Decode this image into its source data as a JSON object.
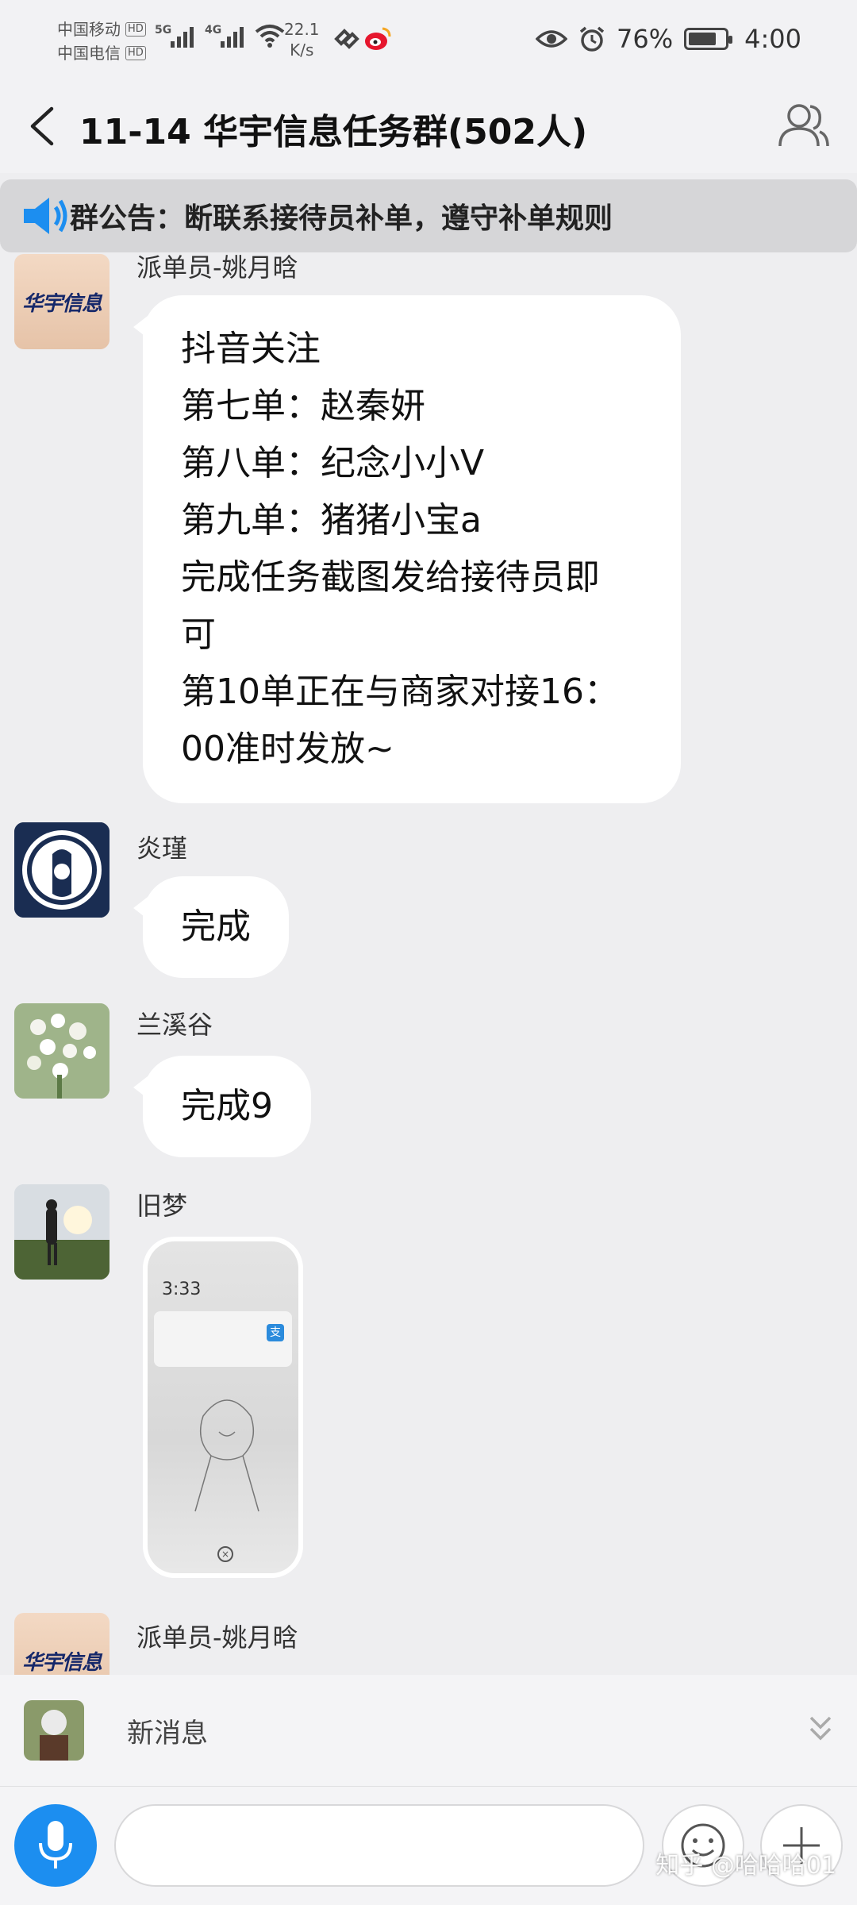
{
  "status_bar": {
    "carrier1": "中国移动",
    "carrier2": "中国电信",
    "hd_badge": "HD",
    "net1": "5G",
    "net2": "4G",
    "speed_value": "22.1",
    "speed_unit": "K/s",
    "battery_percent": "76%",
    "battery_level": 0.76,
    "time": "4:00"
  },
  "header": {
    "title": "11-14  华宇信息任务群(502人)",
    "back_icon": "chevron-left-icon",
    "members_icon": "group-members-icon"
  },
  "announcement": {
    "label": "群公告：",
    "text": "断联系接待员补单，遵守补单规则"
  },
  "messages": [
    {
      "sender": "派单员-姚月晗",
      "avatar_text": "华宇信息",
      "lines": [
        "抖音关注",
        "第七单：赵秦妍",
        "第八单：纪念小小V",
        "第九单：猪猪小宝a",
        "完成任务截图发给接待员即",
        "可",
        "第10单正在与商家对接16：",
        "00准时发放~"
      ]
    },
    {
      "sender": "炎瑾",
      "text": "完成"
    },
    {
      "sender": "兰溪谷",
      "text": "完成9"
    },
    {
      "sender": "旧梦",
      "image": {
        "clock": "3:33"
      }
    },
    {
      "sender": "派单员-姚月晗",
      "avatar_text": "华宇信息"
    }
  ],
  "new_message_bar": {
    "label": "新消息"
  },
  "input_bar": {
    "placeholder": "",
    "mic_icon": "microphone-icon",
    "emoji_icon": "smiley-icon",
    "plus_icon": "plus-icon"
  },
  "watermark": "知乎 @哈哈哈01",
  "colors": {
    "accent": "#1c8ef0",
    "background": "#eeeef0",
    "bubble": "#ffffff",
    "announcement_bg": "#d6d6d8",
    "logo_navy": "#16286a"
  }
}
